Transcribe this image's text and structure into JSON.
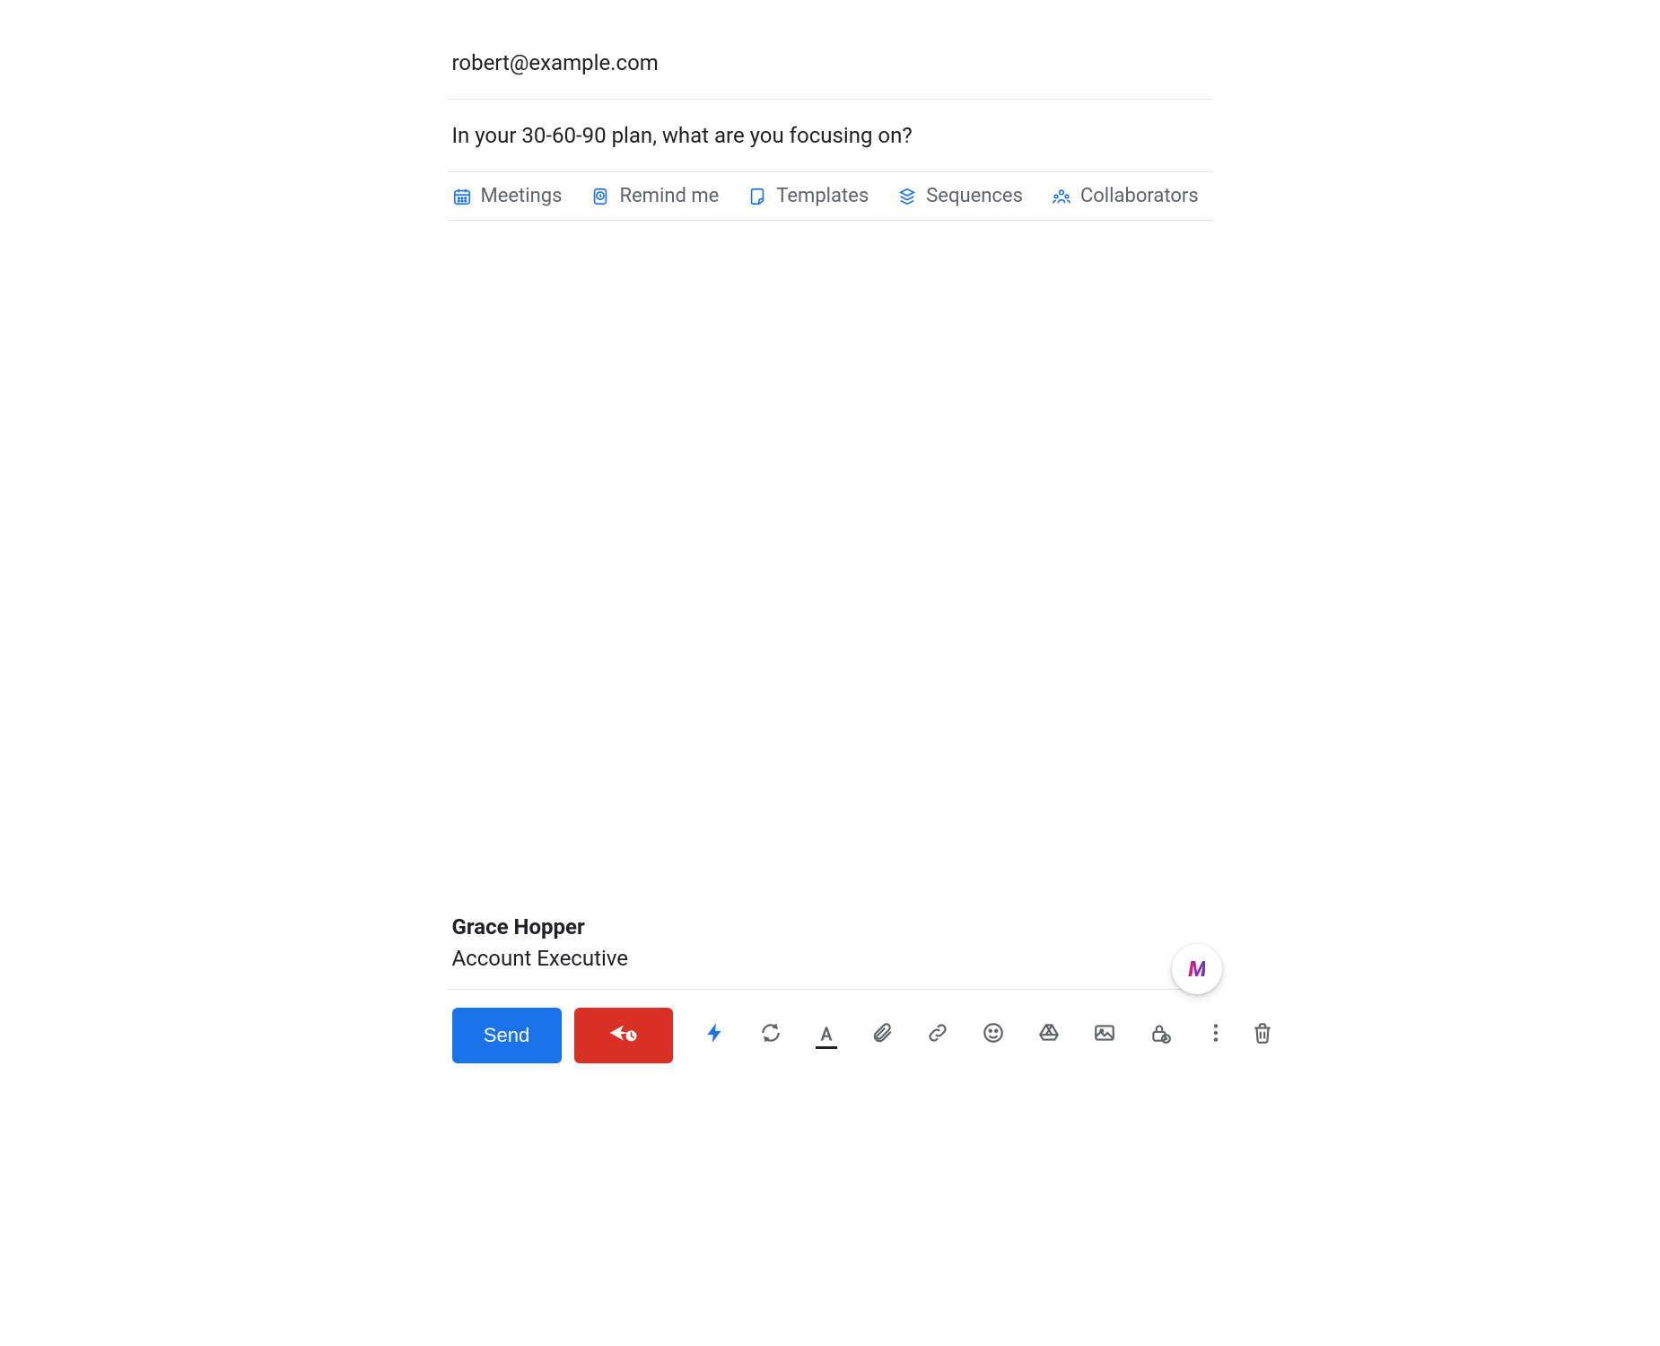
{
  "recipient": "robert@example.com",
  "subject": "In your 30-60-90 plan, what are you focusing on?",
  "ext_tools": {
    "meetings": "Meetings",
    "remind": "Remind me",
    "templates": "Templates",
    "sequences": "Sequences",
    "collaborators": "Collaborators"
  },
  "signature": {
    "name": "Grace Hopper",
    "title": "Account Executive"
  },
  "fab_logo": "M",
  "actions": {
    "send": "Send"
  },
  "icons": {
    "calendar": "calendar-icon",
    "clock": "clock-icon",
    "note": "note-icon",
    "stack": "stack-icon",
    "people": "people-icon",
    "bolt": "bolt-icon",
    "refresh": "refresh-icon",
    "text_color": "text-color-icon",
    "attach": "paperclip-icon",
    "link": "link-icon",
    "emoji": "emoji-icon",
    "drive": "drive-icon",
    "image": "image-icon",
    "confidential": "lock-clock-icon",
    "more": "more-vert-icon",
    "trash": "trash-icon",
    "send_later": "send-later-icon"
  }
}
